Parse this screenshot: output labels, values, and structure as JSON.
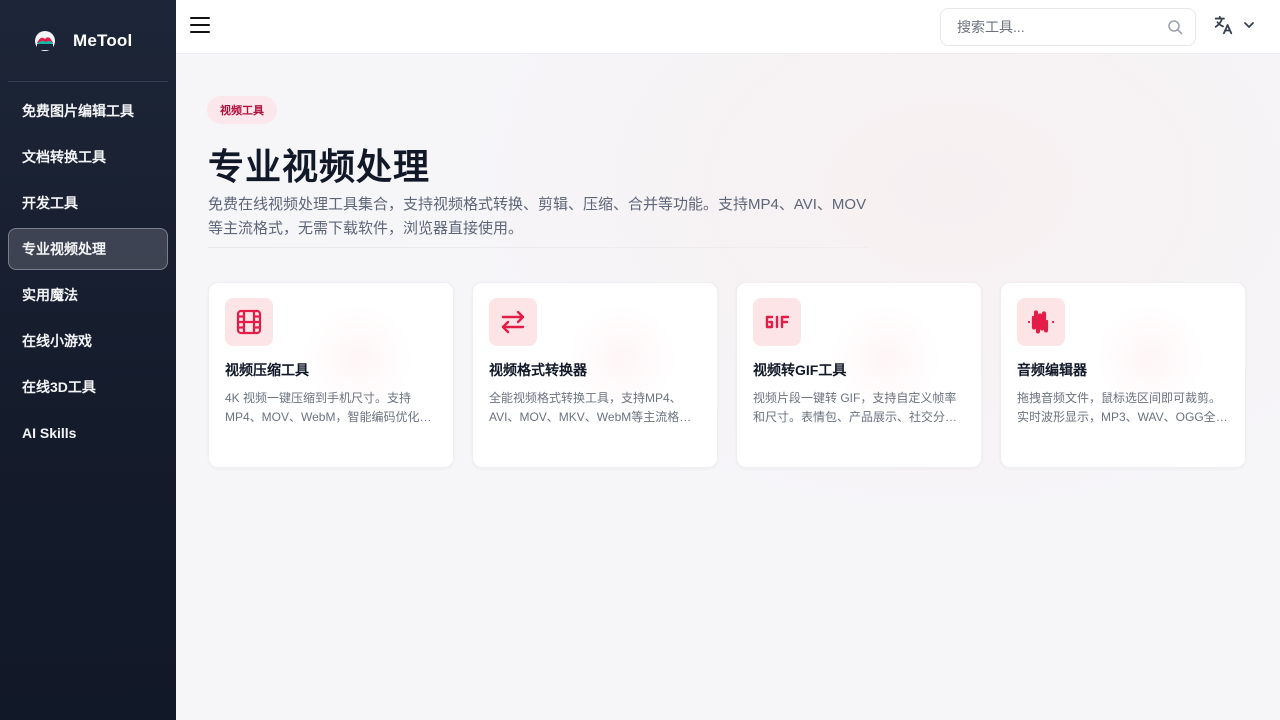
{
  "brand": {
    "name": "MeTool"
  },
  "sidebar": {
    "items": [
      {
        "label": "免费图片编辑工具",
        "active": false
      },
      {
        "label": "文档转换工具",
        "active": false
      },
      {
        "label": "开发工具",
        "active": false
      },
      {
        "label": "专业视频处理",
        "active": true
      },
      {
        "label": "实用魔法",
        "active": false
      },
      {
        "label": "在线小游戏",
        "active": false
      },
      {
        "label": "在线3D工具",
        "active": false
      },
      {
        "label": "AI Skills",
        "active": false
      }
    ]
  },
  "header": {
    "search": {
      "placeholder": "搜索工具...",
      "value": ""
    },
    "language_icon": "translate-icon"
  },
  "main": {
    "badge": "视频工具",
    "title": "专业视频处理",
    "description": "免费在线视频处理工具集合，支持视频格式转换、剪辑、压缩、合并等功能。支持MP4、AVI、MOV等主流格式，无需下载软件，浏览器直接使用。",
    "cards": [
      {
        "icon": "film-icon",
        "title": "视频压缩工具",
        "description": "4K 视频一键压缩到手机尺寸。支持MP4、MOV、WebM，智能编码优化，压缩后画质清晰。"
      },
      {
        "icon": "swap-arrows-icon",
        "title": "视频格式转换器",
        "description": "全能视频格式转换工具，支持MP4、AVI、MOV、MKV、WebM等主流格式互相转换。"
      },
      {
        "icon": "gif-icon",
        "title": "视频转GIF工具",
        "description": "视频片段一键转 GIF，支持自定义帧率和尺寸。表情包、产品展示、社交分享 — 一键生成。"
      },
      {
        "icon": "audio-wave-icon",
        "title": "音频编辑器",
        "description": "拖拽音频文件，鼠标选区间即可裁剪。实时波形显示，MP3、WAV、OGG全格式支持。"
      }
    ]
  },
  "colors": {
    "accent": "#e11d48",
    "sidebar_bg": "#141b2b",
    "badge_bg": "#fce7ec",
    "icon_bg": "#fde4e6"
  }
}
